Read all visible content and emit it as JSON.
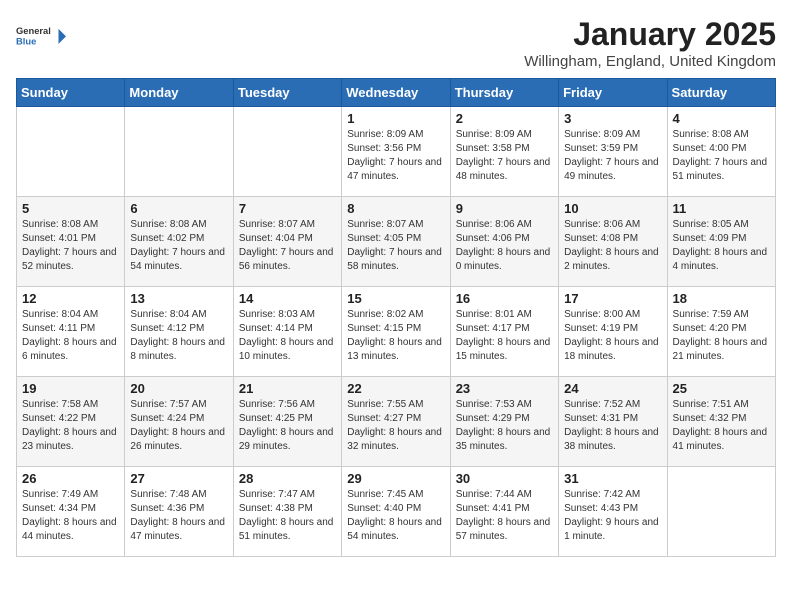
{
  "logo": {
    "line1": "General",
    "line2": "Blue"
  },
  "title": "January 2025",
  "subtitle": "Willingham, England, United Kingdom",
  "weekdays": [
    "Sunday",
    "Monday",
    "Tuesday",
    "Wednesday",
    "Thursday",
    "Friday",
    "Saturday"
  ],
  "weeks": [
    [
      {
        "day": "",
        "info": ""
      },
      {
        "day": "",
        "info": ""
      },
      {
        "day": "",
        "info": ""
      },
      {
        "day": "1",
        "info": "Sunrise: 8:09 AM\nSunset: 3:56 PM\nDaylight: 7 hours and 47 minutes."
      },
      {
        "day": "2",
        "info": "Sunrise: 8:09 AM\nSunset: 3:58 PM\nDaylight: 7 hours and 48 minutes."
      },
      {
        "day": "3",
        "info": "Sunrise: 8:09 AM\nSunset: 3:59 PM\nDaylight: 7 hours and 49 minutes."
      },
      {
        "day": "4",
        "info": "Sunrise: 8:08 AM\nSunset: 4:00 PM\nDaylight: 7 hours and 51 minutes."
      }
    ],
    [
      {
        "day": "5",
        "info": "Sunrise: 8:08 AM\nSunset: 4:01 PM\nDaylight: 7 hours and 52 minutes."
      },
      {
        "day": "6",
        "info": "Sunrise: 8:08 AM\nSunset: 4:02 PM\nDaylight: 7 hours and 54 minutes."
      },
      {
        "day": "7",
        "info": "Sunrise: 8:07 AM\nSunset: 4:04 PM\nDaylight: 7 hours and 56 minutes."
      },
      {
        "day": "8",
        "info": "Sunrise: 8:07 AM\nSunset: 4:05 PM\nDaylight: 7 hours and 58 minutes."
      },
      {
        "day": "9",
        "info": "Sunrise: 8:06 AM\nSunset: 4:06 PM\nDaylight: 8 hours and 0 minutes."
      },
      {
        "day": "10",
        "info": "Sunrise: 8:06 AM\nSunset: 4:08 PM\nDaylight: 8 hours and 2 minutes."
      },
      {
        "day": "11",
        "info": "Sunrise: 8:05 AM\nSunset: 4:09 PM\nDaylight: 8 hours and 4 minutes."
      }
    ],
    [
      {
        "day": "12",
        "info": "Sunrise: 8:04 AM\nSunset: 4:11 PM\nDaylight: 8 hours and 6 minutes."
      },
      {
        "day": "13",
        "info": "Sunrise: 8:04 AM\nSunset: 4:12 PM\nDaylight: 8 hours and 8 minutes."
      },
      {
        "day": "14",
        "info": "Sunrise: 8:03 AM\nSunset: 4:14 PM\nDaylight: 8 hours and 10 minutes."
      },
      {
        "day": "15",
        "info": "Sunrise: 8:02 AM\nSunset: 4:15 PM\nDaylight: 8 hours and 13 minutes."
      },
      {
        "day": "16",
        "info": "Sunrise: 8:01 AM\nSunset: 4:17 PM\nDaylight: 8 hours and 15 minutes."
      },
      {
        "day": "17",
        "info": "Sunrise: 8:00 AM\nSunset: 4:19 PM\nDaylight: 8 hours and 18 minutes."
      },
      {
        "day": "18",
        "info": "Sunrise: 7:59 AM\nSunset: 4:20 PM\nDaylight: 8 hours and 21 minutes."
      }
    ],
    [
      {
        "day": "19",
        "info": "Sunrise: 7:58 AM\nSunset: 4:22 PM\nDaylight: 8 hours and 23 minutes."
      },
      {
        "day": "20",
        "info": "Sunrise: 7:57 AM\nSunset: 4:24 PM\nDaylight: 8 hours and 26 minutes."
      },
      {
        "day": "21",
        "info": "Sunrise: 7:56 AM\nSunset: 4:25 PM\nDaylight: 8 hours and 29 minutes."
      },
      {
        "day": "22",
        "info": "Sunrise: 7:55 AM\nSunset: 4:27 PM\nDaylight: 8 hours and 32 minutes."
      },
      {
        "day": "23",
        "info": "Sunrise: 7:53 AM\nSunset: 4:29 PM\nDaylight: 8 hours and 35 minutes."
      },
      {
        "day": "24",
        "info": "Sunrise: 7:52 AM\nSunset: 4:31 PM\nDaylight: 8 hours and 38 minutes."
      },
      {
        "day": "25",
        "info": "Sunrise: 7:51 AM\nSunset: 4:32 PM\nDaylight: 8 hours and 41 minutes."
      }
    ],
    [
      {
        "day": "26",
        "info": "Sunrise: 7:49 AM\nSunset: 4:34 PM\nDaylight: 8 hours and 44 minutes."
      },
      {
        "day": "27",
        "info": "Sunrise: 7:48 AM\nSunset: 4:36 PM\nDaylight: 8 hours and 47 minutes."
      },
      {
        "day": "28",
        "info": "Sunrise: 7:47 AM\nSunset: 4:38 PM\nDaylight: 8 hours and 51 minutes."
      },
      {
        "day": "29",
        "info": "Sunrise: 7:45 AM\nSunset: 4:40 PM\nDaylight: 8 hours and 54 minutes."
      },
      {
        "day": "30",
        "info": "Sunrise: 7:44 AM\nSunset: 4:41 PM\nDaylight: 8 hours and 57 minutes."
      },
      {
        "day": "31",
        "info": "Sunrise: 7:42 AM\nSunset: 4:43 PM\nDaylight: 9 hours and 1 minute."
      },
      {
        "day": "",
        "info": ""
      }
    ]
  ]
}
